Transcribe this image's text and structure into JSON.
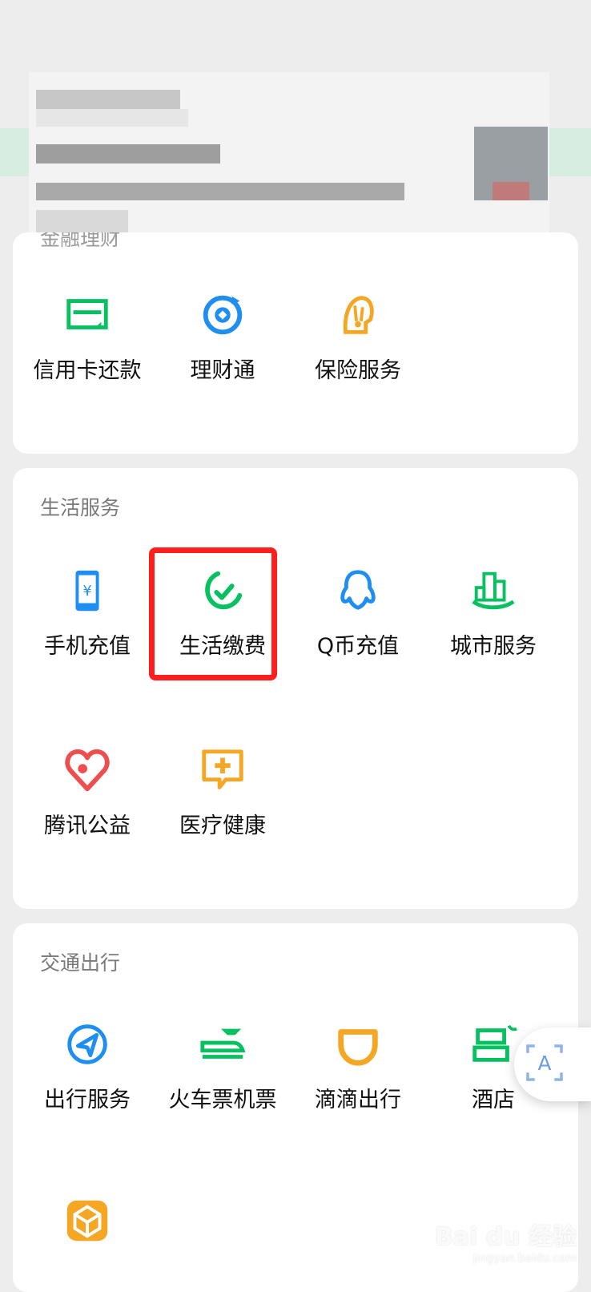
{
  "sections": {
    "finance": {
      "title": "金融理财",
      "items": [
        {
          "label": "信用卡还款",
          "icon": "credit-card-icon"
        },
        {
          "label": "理财通",
          "icon": "wealth-icon"
        },
        {
          "label": "保险服务",
          "icon": "insurance-icon"
        }
      ]
    },
    "life": {
      "title": "生活服务",
      "items": [
        {
          "label": "手机充值",
          "icon": "mobile-topup-icon"
        },
        {
          "label": "生活缴费",
          "icon": "utility-payment-icon"
        },
        {
          "label": "Q币充值",
          "icon": "qq-coin-icon"
        },
        {
          "label": "城市服务",
          "icon": "city-service-icon"
        },
        {
          "label": "腾讯公益",
          "icon": "charity-icon"
        },
        {
          "label": "医疗健康",
          "icon": "medical-icon"
        }
      ]
    },
    "transport": {
      "title": "交通出行",
      "items": [
        {
          "label": "出行服务",
          "icon": "travel-icon"
        },
        {
          "label": "火车票机票",
          "icon": "train-plane-icon"
        },
        {
          "label": "滴滴出行",
          "icon": "didi-icon"
        },
        {
          "label": "酒店",
          "icon": "hotel-icon"
        }
      ]
    }
  },
  "watermark": {
    "brand": "Bai du 经验",
    "url": "jingyan.baidu.com"
  },
  "colors": {
    "green": "#07c160",
    "blue": "#1e8ef0",
    "orange": "#f5a623",
    "red": "#ef4e4e",
    "highlight": "#ff1e1e"
  }
}
